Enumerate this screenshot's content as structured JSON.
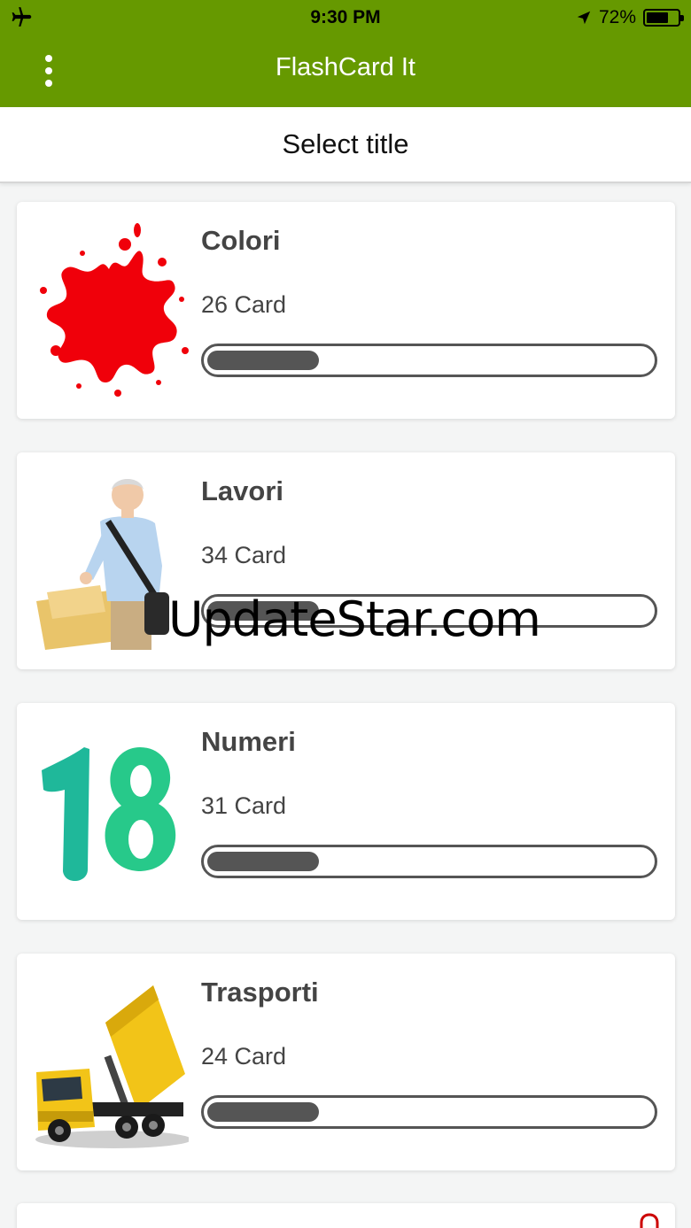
{
  "status_bar": {
    "time": "9:30 PM",
    "battery_text": "72%",
    "battery_level": 0.72,
    "icons": [
      "airplane-icon",
      "location-arrow-icon",
      "battery-icon"
    ]
  },
  "app_bar": {
    "title": "FlashCard It",
    "background": "#669900",
    "menu_icon": "more-vertical-icon"
  },
  "subheader": {
    "title": "Select title"
  },
  "cards": [
    {
      "title": "Colori",
      "count": "26 Card",
      "progress": 0.25,
      "image": "paint-splash-icon"
    },
    {
      "title": "Lavori",
      "count": "34 Card",
      "progress": 0.25,
      "image": "postman-photo"
    },
    {
      "title": "Numeri",
      "count": "31 Card",
      "progress": 0.25,
      "image": "number-18-icon"
    },
    {
      "title": "Trasporti",
      "count": "24 Card",
      "progress": 0.25,
      "image": "dump-truck-photo"
    }
  ],
  "watermark": "UpdateStar.com"
}
